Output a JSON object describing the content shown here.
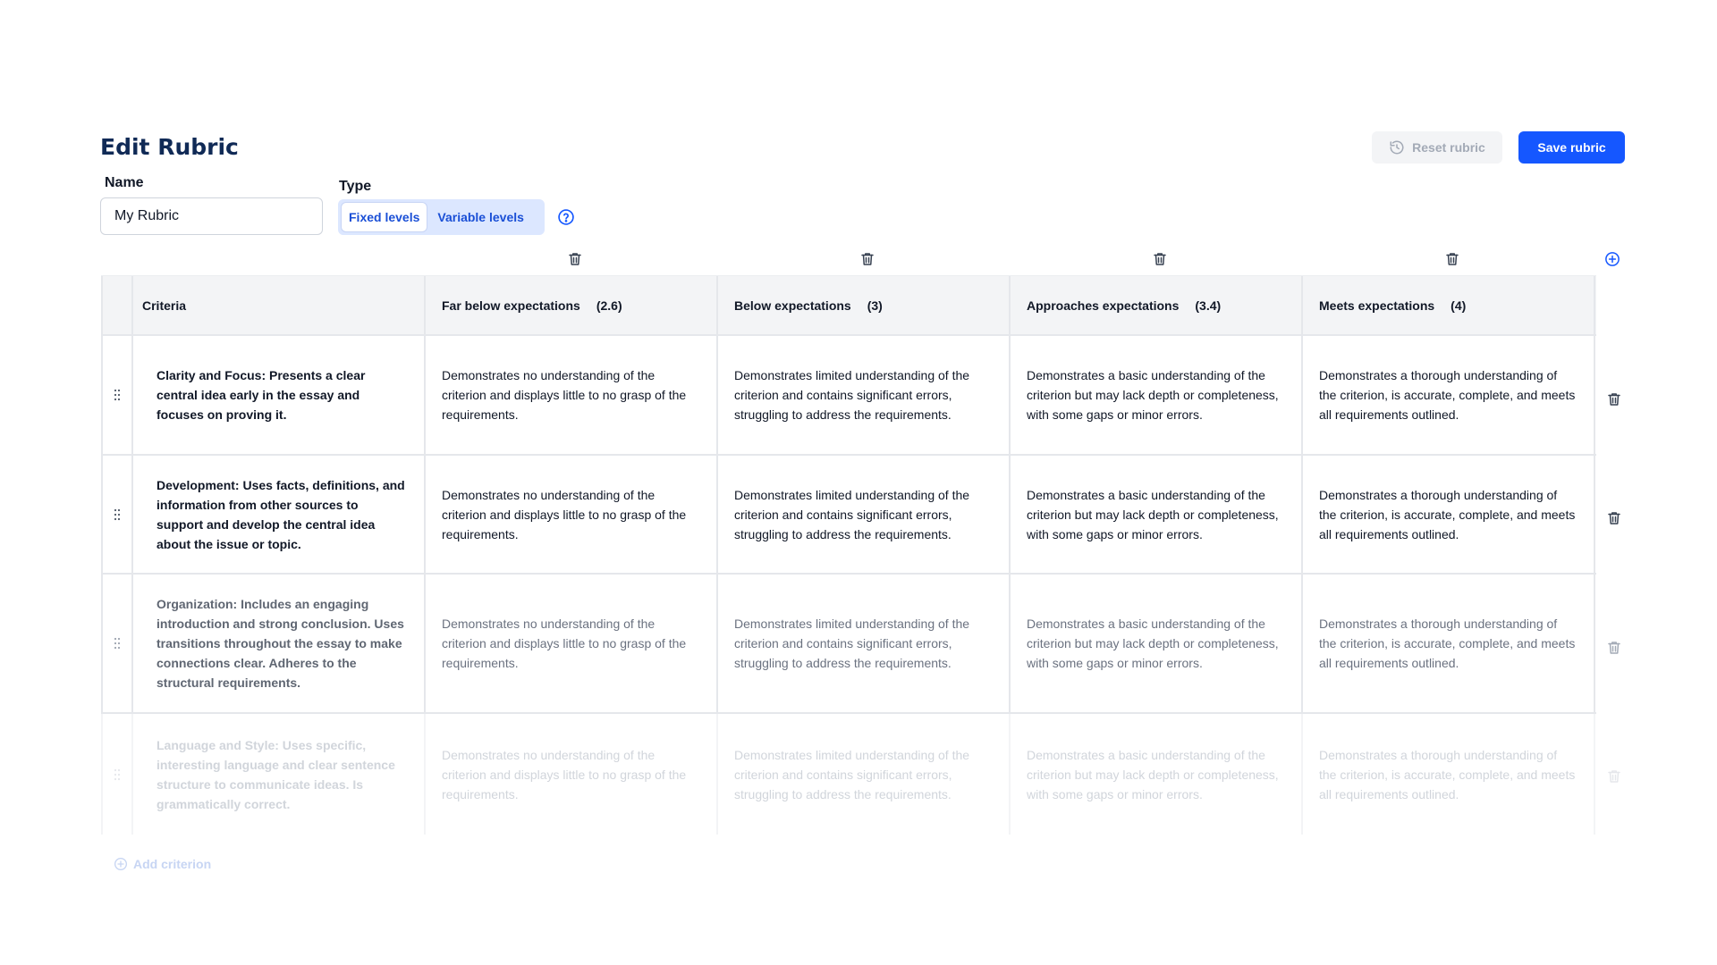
{
  "header": {
    "title": "Edit Rubric",
    "reset_label": "Reset rubric",
    "save_label": "Save rubric"
  },
  "form": {
    "name_label": "Name",
    "name_value": "My Rubric",
    "type_label": "Type",
    "type_options": [
      "Fixed levels",
      "Variable levels"
    ],
    "type_selected": "Fixed levels"
  },
  "table": {
    "criteria_header": "Criteria",
    "levels": [
      {
        "name": "Far below expectations",
        "score": "(2.6)"
      },
      {
        "name": "Below expectations",
        "score": "(3)"
      },
      {
        "name": "Approaches expectations",
        "score": "(3.4)"
      },
      {
        "name": "Meets expectations",
        "score": "(4)"
      }
    ],
    "rows": [
      {
        "criterion": "Clarity and Focus: Presents a clear central idea early in the essay and focuses on proving it.",
        "cells": [
          "Demonstrates no understanding of the criterion and displays little to no grasp of the requirements.",
          "Demonstrates limited understanding of the criterion and contains significant errors, struggling to address the requirements.",
          "Demonstrates a basic understanding of the criterion but may lack depth or completeness, with some gaps or minor errors.",
          "Demonstrates a thorough understanding of the criterion, is accurate, complete, and meets all requirements outlined."
        ]
      },
      {
        "criterion": "Development: Uses facts, definitions, and information from other sources to support and develop the central idea about the issue or topic.",
        "cells": [
          "Demonstrates no understanding of the criterion and displays little to no grasp of the requirements.",
          "Demonstrates limited understanding of the criterion and contains significant errors, struggling to address the requirements.",
          "Demonstrates a basic understanding of the criterion but may lack depth or completeness, with some gaps or minor errors.",
          "Demonstrates a thorough understanding of the criterion, is accurate, complete, and meets all requirements outlined."
        ]
      },
      {
        "criterion": "Organization: Includes an engaging introduction and strong conclusion. Uses transitions throughout the essay to make connections clear. Adheres to the structural requirements.",
        "cells": [
          "Demonstrates no understanding of the criterion and displays little to no grasp of the requirements.",
          "Demonstrates limited understanding of the criterion and contains significant errors, struggling to address the requirements.",
          "Demonstrates a basic understanding of the criterion but may lack depth or completeness, with some gaps or minor errors.",
          "Demonstrates a thorough understanding of the criterion, is accurate, complete, and meets all requirements outlined."
        ]
      },
      {
        "criterion": "Language and Style: Uses specific, interesting language and clear sentence structure to communicate ideas. Is grammatically correct.",
        "cells": [
          "Demonstrates no understanding of the criterion and displays little to no grasp of the requirements.",
          "Demonstrates limited understanding of the criterion and contains significant errors, struggling to address the requirements.",
          "Demonstrates a basic understanding of the criterion but may lack depth or completeness, with some gaps or minor errors.",
          "Demonstrates a thorough understanding of the criterion, is accurate, complete, and meets all requirements outlined."
        ]
      }
    ],
    "add_criterion_label": "Add criterion"
  },
  "colors": {
    "primary": "#1557ff",
    "title": "#102a56",
    "segment_bg": "#dce7ff",
    "header_bg": "#f3f4f6"
  },
  "icons": {
    "reset": "history-icon",
    "help": "help-circle-icon",
    "delete": "trash-icon",
    "add_column": "plus-circle-icon",
    "drag": "drag-handle-icon"
  }
}
